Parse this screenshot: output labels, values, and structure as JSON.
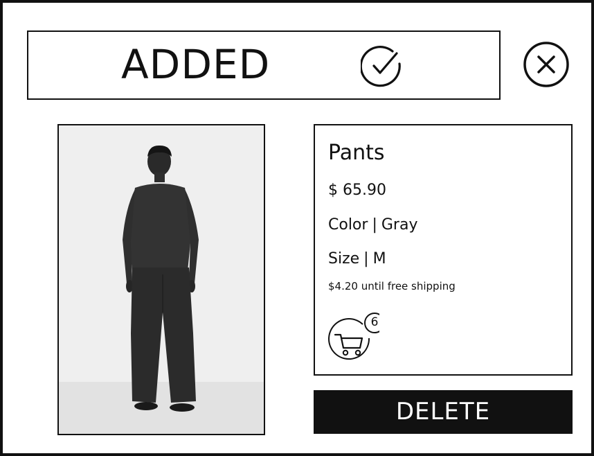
{
  "banner": {
    "status_text": "ADDED",
    "status_icon": "check-circle-icon"
  },
  "close": {
    "icon": "close-icon"
  },
  "product": {
    "image_icon": "product-photo",
    "name": "Pants",
    "price": "$ 65.90",
    "color": {
      "label": "Color",
      "separator": "|",
      "value": "Gray"
    },
    "size": {
      "label": "Size",
      "separator": "|",
      "value": "M"
    },
    "shipping_note": "$4.20 until free shipping"
  },
  "cart": {
    "icon": "cart-icon",
    "count": "6"
  },
  "actions": {
    "delete_label": "DELETE"
  },
  "colors": {
    "ink": "#111111",
    "background": "#ffffff",
    "button_text": "#ffffff"
  }
}
